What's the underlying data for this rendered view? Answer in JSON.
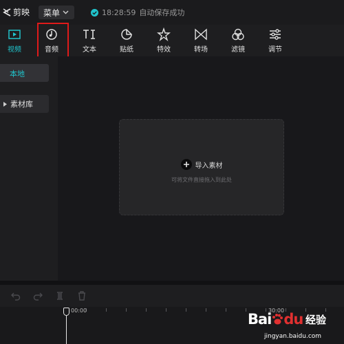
{
  "app": {
    "name": "剪映"
  },
  "menu": {
    "label": "菜单"
  },
  "save_status": {
    "time": "18:28:59",
    "text": "自动保存成功",
    "color": "#20c4cc"
  },
  "toolbar": {
    "items": [
      {
        "label": "视频",
        "icon": "video-icon",
        "active": true
      },
      {
        "label": "音频",
        "icon": "audio-icon",
        "highlighted": true
      },
      {
        "label": "文本",
        "icon": "text-icon"
      },
      {
        "label": "贴纸",
        "icon": "sticker-icon"
      },
      {
        "label": "特效",
        "icon": "effects-icon"
      },
      {
        "label": "转场",
        "icon": "transition-icon"
      },
      {
        "label": "滤镜",
        "icon": "filter-icon"
      },
      {
        "label": "调节",
        "icon": "adjust-icon"
      }
    ],
    "accent_color": "#20c4cc",
    "highlight_color": "#e01a1a"
  },
  "sidebar": {
    "local": "本地",
    "library": "素材库"
  },
  "import": {
    "label": "导入素材",
    "hint": "可将文件直接拖入到此处"
  },
  "timeline": {
    "toolbar_icons": [
      "undo-icon",
      "redo-icon",
      "split-icon",
      "delete-icon"
    ],
    "start_time": "00:00",
    "mark_time": "30:00"
  },
  "watermark": {
    "brand": "Bai",
    "brand_du": "du",
    "brand_cn": "经验",
    "url": "jingyan.baidu.com"
  }
}
